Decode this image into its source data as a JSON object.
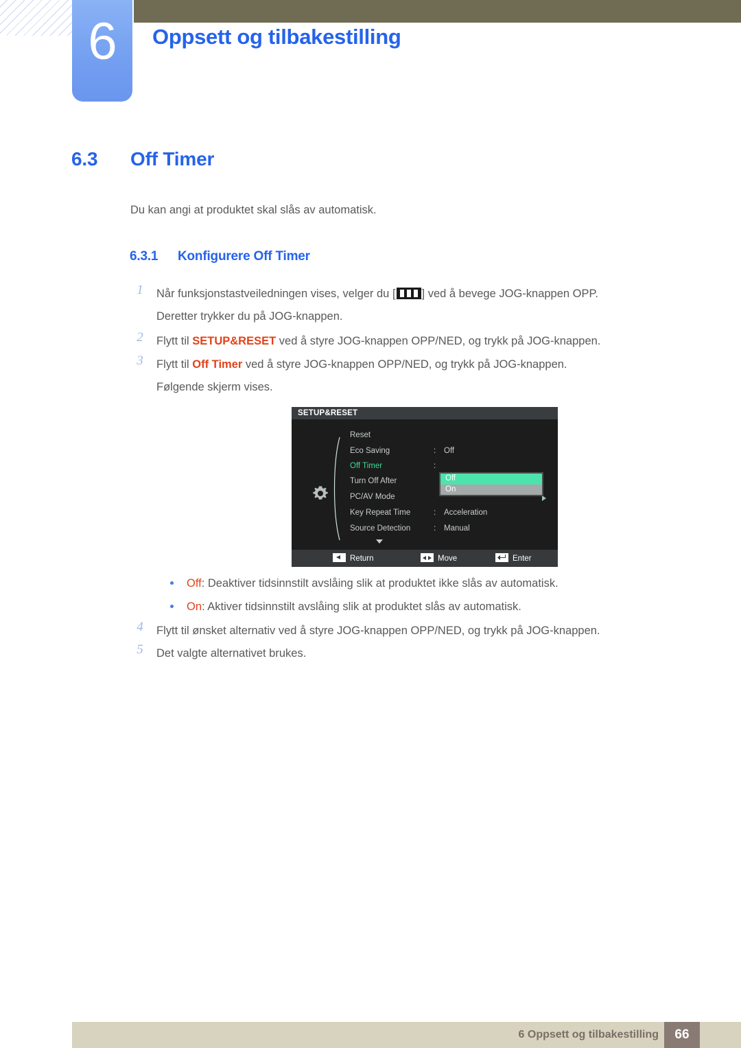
{
  "header": {
    "chapter_number": "6",
    "chapter_title": "Oppsett og tilbakestilling",
    "accent_blue": "#2563eb",
    "badge_blue": "#7aa5f2",
    "bar_olive": "#706b53"
  },
  "section": {
    "number": "6.3",
    "title": "Off Timer",
    "intro": "Du kan angi at produktet skal slås av automatisk.",
    "sub_number": "6.3.1",
    "sub_title": "Konfigurere Off Timer"
  },
  "steps": [
    {
      "num": "1",
      "pre": "Når funksjonstastveiledningen vises, velger du [",
      "post": "] ved å bevege JOG-knappen OPP.",
      "line2": "Deretter trykker du på JOG-knappen.",
      "icon": "menu-bars-icon"
    },
    {
      "num": "2",
      "pre": "Flytt til ",
      "emph": "SETUP&RESET",
      "post": " ved å styre JOG-knappen OPP/NED, og trykk på JOG-knappen."
    },
    {
      "num": "3",
      "pre": "Flytt til ",
      "emph": "Off Timer",
      "post": " ved å styre JOG-knappen OPP/NED, og trykk på JOG-knappen.",
      "line2": "Følgende skjerm vises."
    },
    {
      "num": "4",
      "pre": "Flytt til ønsket alternativ ved å styre JOG-knappen OPP/NED, og trykk på JOG-knappen."
    },
    {
      "num": "5",
      "pre": "Det valgte alternativet brukes."
    }
  ],
  "bullets": [
    {
      "emph": "Off",
      "text": ": Deaktiver tidsinnstilt avslåing slik at produktet ikke slås av automatisk."
    },
    {
      "emph": "On",
      "text": ": Aktiver tidsinnstilt avslåing slik at produktet slås av automatisk."
    }
  ],
  "osd": {
    "title": "SETUP&RESET",
    "selected_item": "Off Timer",
    "selected_color": "#3ddc97",
    "highlight_color": "#4de3ad",
    "items": [
      {
        "label": "Reset",
        "colon": "",
        "value": ""
      },
      {
        "label": "Eco Saving",
        "colon": ":",
        "value": "Off"
      },
      {
        "label": "Off Timer",
        "colon": ":",
        "value": ""
      },
      {
        "label": "Turn Off After",
        "colon": "",
        "value": ""
      },
      {
        "label": "PC/AV Mode",
        "colon": "",
        "value": ""
      },
      {
        "label": "Key Repeat Time",
        "colon": ":",
        "value": "Acceleration"
      },
      {
        "label": "Source Detection",
        "colon": ":",
        "value": "Manual"
      }
    ],
    "dropdown": {
      "options": [
        "Off",
        "On"
      ],
      "selected": "Off"
    },
    "footer": [
      {
        "label": "Return",
        "icon": "left-arrow-button-icon"
      },
      {
        "label": "Move",
        "icon": "left-right-arrow-button-icon"
      },
      {
        "label": "Enter",
        "icon": "enter-button-icon"
      }
    ]
  },
  "footer": {
    "text": "6 Oppsett og tilbakestilling",
    "page": "66",
    "bar_color": "#d8d3be",
    "page_box_color": "#897b74"
  }
}
